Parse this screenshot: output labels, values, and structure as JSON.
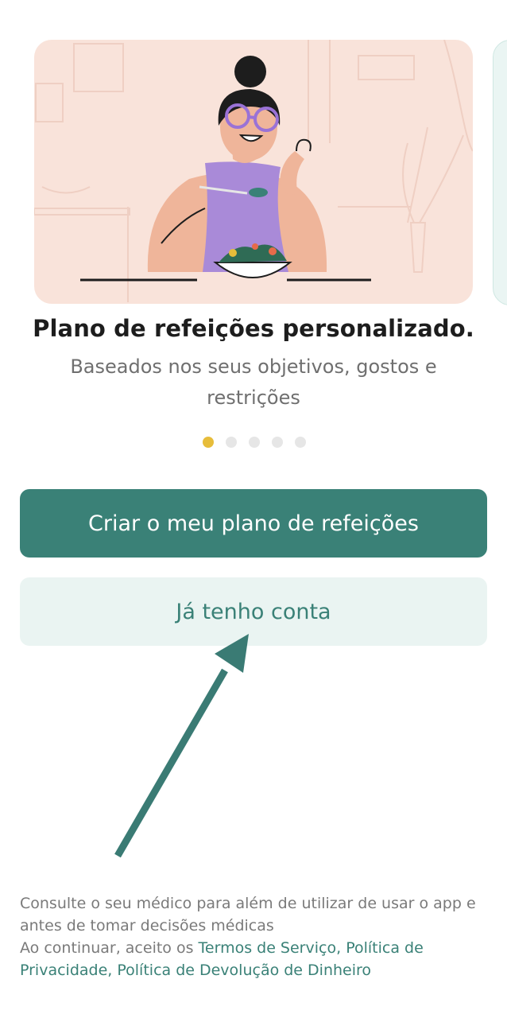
{
  "onboarding": {
    "title": "Plano de refeições personalizado.",
    "subtitle": "Baseados nos seus objetivos, gostos e restrições",
    "pager": {
      "page_count": 5,
      "active_index": 0
    },
    "illustration_icon": "woman-eating-salad-illustration"
  },
  "actions": {
    "primary_label": "Criar o meu plano de refeições",
    "secondary_label": "Já tenho conta"
  },
  "footer": {
    "disclaimer_line1": "Consulte o seu médico para além de utilizar de usar o app e antes de tomar decisões médicas",
    "consent_prefix": "Ao continuar, aceito os ",
    "terms_link": "Termos de Serviço",
    "separator1": ", ",
    "privacy_link": "Política de Privacidade",
    "separator2": ", ",
    "refund_link": "Política de Devolução de Dinheiro"
  },
  "colors": {
    "accent": "#3a8177",
    "accent_light": "#eaf4f2",
    "pager_active": "#e7bd3a",
    "pager_inactive": "#e6e6e6",
    "card_background": "#f9e3da"
  }
}
